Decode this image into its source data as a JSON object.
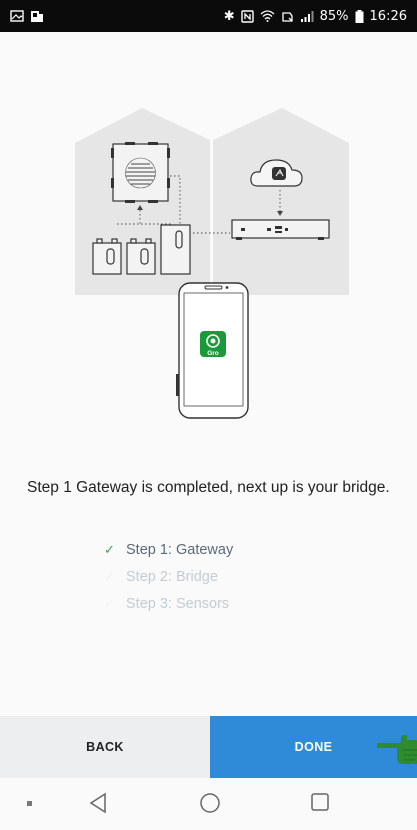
{
  "status_bar": {
    "battery": "85%",
    "time": "16:26"
  },
  "illustration": {
    "app_label": "Gro",
    "accent_green": "#1b9a3c"
  },
  "message": "Step 1 Gateway is completed, next up is your bridge.",
  "steps": [
    {
      "label": "Step 1: Gateway",
      "status": "completed"
    },
    {
      "label": "Step 2: Bridge",
      "status": "pending"
    },
    {
      "label": "Step 3: Sensors",
      "status": "pending"
    }
  ],
  "buttons": {
    "back": "BACK",
    "done": "DONE"
  },
  "colors": {
    "primary": "#2f8ad8",
    "check": "#3ea34a"
  },
  "nav_icons": [
    "recent-dot-icon",
    "back-triangle-icon",
    "home-circle-icon",
    "overview-square-icon"
  ]
}
